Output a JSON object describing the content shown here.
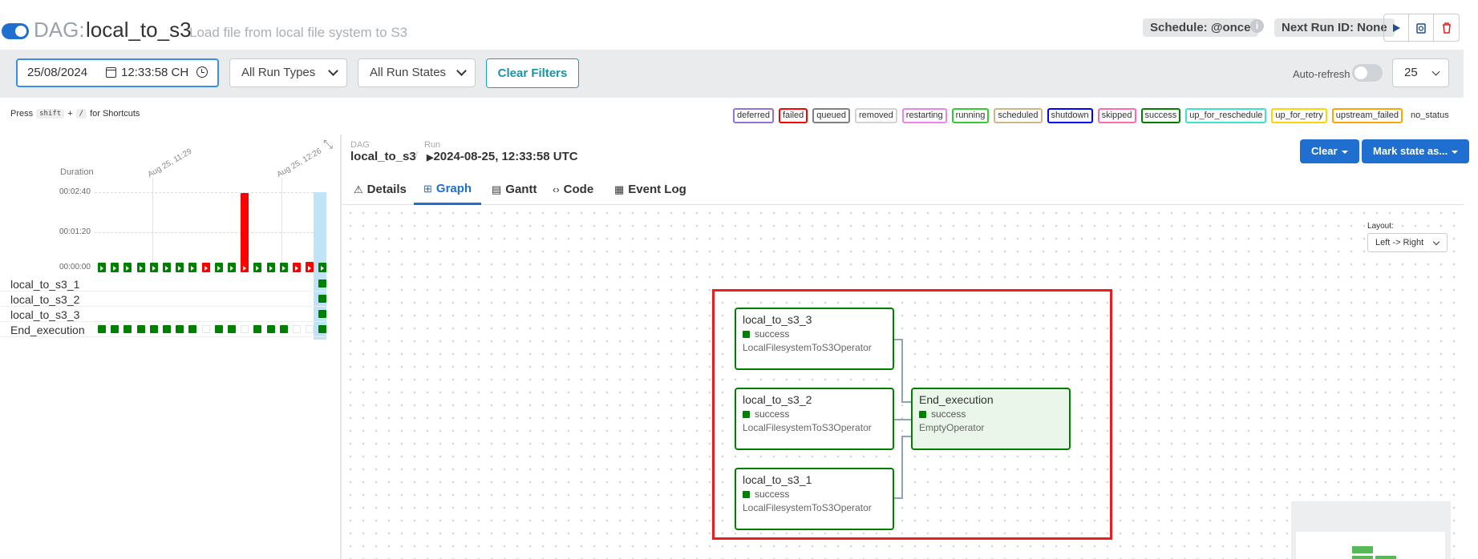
{
  "header": {
    "dag_prefix": "DAG:",
    "dag_id": "local_to_s3",
    "description": "Load file from local file system to S3",
    "schedule": "Schedule: @once",
    "next_run": "Next Run ID: None",
    "info_glyph": "i",
    "buttons": [
      "trigger-dag-icon",
      "refresh-dag-icon",
      "delete-dag-icon"
    ],
    "paused": false
  },
  "filters": {
    "date": "25/08/2024",
    "time": "12:33:58  CH",
    "run_types": "All Run Types",
    "run_states": "All Run States",
    "clear": "Clear Filters",
    "autorefresh": "Auto-refresh",
    "per_page": "25"
  },
  "shortcuts": {
    "press": "Press",
    "key1": "shift",
    "plus": "+",
    "key2": "/",
    "suffix": "for Shortcuts"
  },
  "states": [
    {
      "label": "deferred",
      "color": "#9370db"
    },
    {
      "label": "failed",
      "color": "#ff0000"
    },
    {
      "label": "queued",
      "color": "#808080"
    },
    {
      "label": "removed",
      "color": "#d3d3d3"
    },
    {
      "label": "restarting",
      "color": "#ee82ee"
    },
    {
      "label": "running",
      "color": "#32cd32"
    },
    {
      "label": "scheduled",
      "color": "#d2b48c"
    },
    {
      "label": "shutdown",
      "color": "#0000ff"
    },
    {
      "label": "skipped",
      "color": "#ff69b4"
    },
    {
      "label": "success",
      "color": "#008000"
    },
    {
      "label": "up_for_reschedule",
      "color": "#40e0d0"
    },
    {
      "label": "up_for_retry",
      "color": "#ffd700"
    },
    {
      "label": "upstream_failed",
      "color": "#ffa500"
    }
  ],
  "no_status": "no_status",
  "grid": {
    "duration_label": "Duration",
    "ticks": [
      "00:02:40",
      "00:01:20",
      "00:00:00"
    ],
    "dates": [
      "Aug 25, 11:29",
      "Aug 25, 12:26"
    ],
    "runs": [
      {
        "state": "success",
        "duration_s": 8
      },
      {
        "state": "success",
        "duration_s": 8
      },
      {
        "state": "success",
        "duration_s": 8
      },
      {
        "state": "success",
        "duration_s": 8
      },
      {
        "state": "success",
        "duration_s": 8
      },
      {
        "state": "success",
        "duration_s": 8
      },
      {
        "state": "success",
        "duration_s": 8
      },
      {
        "state": "success",
        "duration_s": 8
      },
      {
        "state": "failed",
        "duration_s": 8
      },
      {
        "state": "success",
        "duration_s": 8
      },
      {
        "state": "success",
        "duration_s": 8
      },
      {
        "state": "failed",
        "duration_s": 159
      },
      {
        "state": "success",
        "duration_s": 8
      },
      {
        "state": "success",
        "duration_s": 13
      },
      {
        "state": "success",
        "duration_s": 8
      },
      {
        "state": "failed",
        "duration_s": 11
      },
      {
        "state": "failed",
        "duration_s": 21
      },
      {
        "state": "success",
        "duration_s": 8
      }
    ],
    "tasks": [
      {
        "name": "local_to_s3_1",
        "cells": [
          "none",
          "none",
          "none",
          "none",
          "none",
          "none",
          "none",
          "none",
          "none",
          "none",
          "none",
          "none",
          "none",
          "none",
          "none",
          "none",
          "none",
          "success"
        ]
      },
      {
        "name": "local_to_s3_2",
        "cells": [
          "none",
          "none",
          "none",
          "none",
          "none",
          "none",
          "none",
          "none",
          "none",
          "none",
          "none",
          "none",
          "none",
          "none",
          "none",
          "none",
          "none",
          "success"
        ]
      },
      {
        "name": "local_to_s3_3",
        "cells": [
          "none",
          "none",
          "none",
          "none",
          "none",
          "none",
          "none",
          "none",
          "none",
          "none",
          "none",
          "none",
          "none",
          "none",
          "none",
          "none",
          "none",
          "success"
        ]
      },
      {
        "name": "End_execution",
        "cells": [
          "success",
          "success",
          "success",
          "success",
          "success",
          "success",
          "success",
          "success",
          "empty",
          "success",
          "success",
          "empty",
          "success",
          "success",
          "success",
          "empty",
          "empty",
          "success"
        ]
      }
    ]
  },
  "breadcrumb": {
    "dag_label": "DAG",
    "dag_value": "local_to_s3",
    "sep": "/",
    "run_label": "Run",
    "run_value": "2024-08-25, 12:33:58 UTC"
  },
  "actions": {
    "clear": "Clear",
    "mark": "Mark state as..."
  },
  "tabs": [
    {
      "label": "Details",
      "icon": "⚠"
    },
    {
      "label": "Graph",
      "icon": "⊞"
    },
    {
      "label": "Gantt",
      "icon": "▤"
    },
    {
      "label": "Code",
      "icon": "‹›"
    },
    {
      "label": "Event Log",
      "icon": "▦"
    }
  ],
  "active_tab": "Graph",
  "layout": {
    "label": "Layout:",
    "value": "Left -> Right"
  },
  "graph": {
    "nodes": [
      {
        "id": "local_to_s3_3",
        "state": "success",
        "operator": "LocalFilesystemToS3Operator"
      },
      {
        "id": "local_to_s3_2",
        "state": "success",
        "operator": "LocalFilesystemToS3Operator"
      },
      {
        "id": "local_to_s3_1",
        "state": "success",
        "operator": "LocalFilesystemToS3Operator"
      },
      {
        "id": "End_execution",
        "state": "success",
        "operator": "EmptyOperator"
      }
    ]
  }
}
